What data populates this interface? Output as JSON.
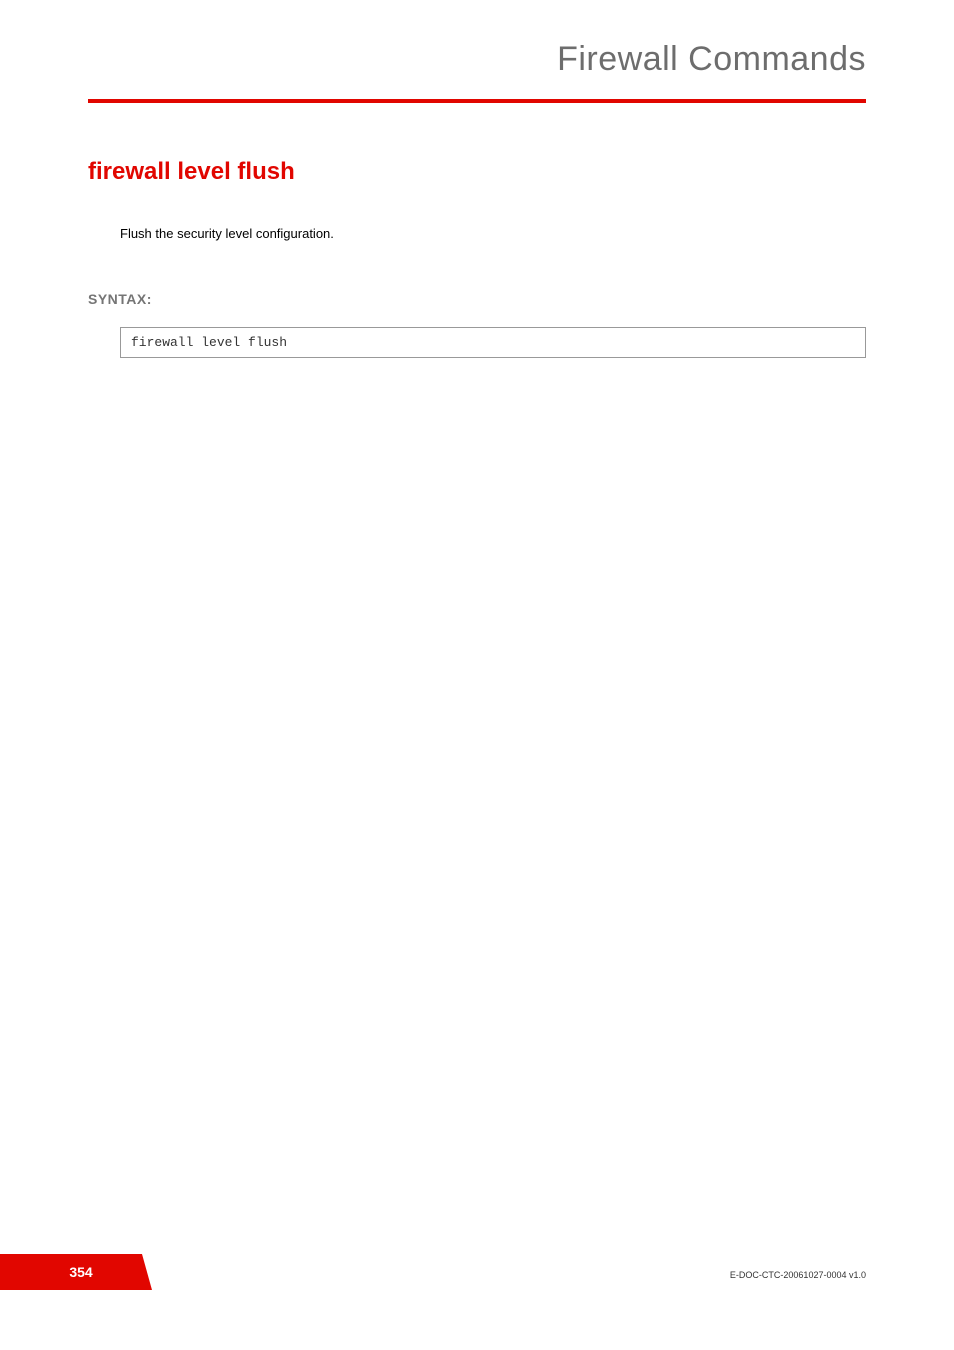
{
  "header": {
    "title": "Firewall Commands"
  },
  "command": {
    "title": "firewall level flush",
    "description": "Flush the security level configuration."
  },
  "syntax": {
    "label": "SYNTAX:",
    "code": "firewall level flush"
  },
  "footer": {
    "page_number": "354",
    "doc_id": "E-DOC-CTC-20061027-0004 v1.0"
  }
}
